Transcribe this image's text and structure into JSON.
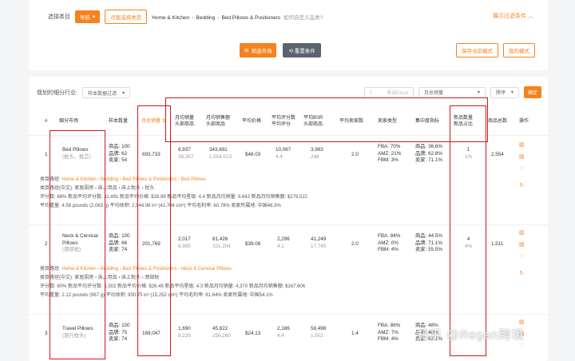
{
  "filters": {
    "category_label": "选择类目",
    "dropdown_label": "导航",
    "choose_category_btn": "点我选择类目",
    "breadcrumb": [
      "Home & Kitchen",
      "Bedding",
      "Bed Pillows & Positioners"
    ],
    "custom_hint": "如何自定义品类?",
    "expand_filters": "展示过滤条件",
    "filter_market_btn": "筛选市场",
    "reset_btn": "重置条件",
    "save_mode_btn": "保存当前模式",
    "my_mode_btn": "我的模式"
  },
  "toolbar": {
    "my_market_label": "我划的细分行业:",
    "sample_select": "样本数据过滤",
    "export": "导出Excel",
    "month_select": "月总销量",
    "order_select": "降序",
    "query_btn": "确定"
  },
  "headers": {
    "no": "#",
    "market": "细分市场",
    "sample": "样本数量",
    "monthly_sales": "月总销量",
    "avg_monthly_sales": [
      "月均销量",
      "头部商品"
    ],
    "avg_monthly_revenue": [
      "月均销售额",
      "头部商品"
    ],
    "avg_price": "平均价格",
    "avg_reviews": [
      "平均评分数",
      "平均评分"
    ],
    "avg_bsr": [
      "平均BSR",
      "头部商品"
    ],
    "avg_sellers": "平均卖家数",
    "seller_type": "卖家类型",
    "concentration": "集中度指标",
    "new_products": [
      "新品数量",
      "新品占比"
    ],
    "total_products": "商品总数",
    "ops": "操作"
  },
  "rows": [
    {
      "name": "Bed Pillows",
      "cn": "(枕头、枕芯)",
      "sample": [
        "商品: 100",
        "品牌: 62",
        "卖家: 54"
      ],
      "monthly_sales": "693,733",
      "avg_sales": [
        "6,937",
        "26,367"
      ],
      "avg_revenue": [
        "343,691",
        "1,554,013"
      ],
      "price": "$48.03",
      "reviews": [
        "10,067",
        "4.4"
      ],
      "bsr": [
        "3,983",
        "248"
      ],
      "sellers": "2.0",
      "seller_type": [
        "FBA: 70%",
        "AMZ: 21%",
        "FBM: 3%"
      ],
      "conc": [
        "商品: 36.6%",
        "品牌: 62.8%",
        "卖家: 71.1%"
      ],
      "new": [
        "1",
        "1%"
      ],
      "total": "2,554",
      "path": "Home & Kitchen › Bedding › Bed Pillows & Positioners › Bed Pillows",
      "path_cn": "家居厨房 › 床上用品 › 床上枕头 › 枕头",
      "stats1": "评分数: 88%    新品平均评分数: 11,491    新品平均价格: $28.99    新品平均星级: 4.4    新品月均销量: 9,642    新品月均销售额: $279,522",
      "stats2": "平均重量: 4.59 pounds (2,083 g)    平均体积: 2,544.96 in³ (41,704 cm³)    平均毛利率: 60.78%    卖家所属地: 中国46.3%"
    },
    {
      "name": "Neck & Cervical Pillows",
      "cn": "(颈部枕)",
      "sample": [
        "商品: 100",
        "品牌: 66",
        "卖家: 74"
      ],
      "monthly_sales": "201,769",
      "avg_sales": [
        "2,017",
        "6,985"
      ],
      "avg_revenue": [
        "81,426",
        "331,204"
      ],
      "price": "$39.06",
      "reviews": [
        "2,296",
        "4.1"
      ],
      "bsr": [
        "41,249",
        "17,745"
      ],
      "sellers": "2.0",
      "seller_type": [
        "FBA: 84%",
        "AMZ: 0%",
        "FBM: 4%"
      ],
      "conc": [
        "商品: 44.5%",
        "品牌: 71.1%",
        "卖家: 55.5%"
      ],
      "new": [
        "4",
        "4%"
      ],
      "total": "1,511",
      "path": "Home & Kitchen › Bedding › Bed Pillows & Positioners › Neck & Cervical Pillows",
      "path_cn": "家居厨房 › 床上用品 › 床上枕头 › 颈部枕",
      "stats1": "评分数: 80%    新品平均评分数: 1,502    新品平均价格: $26.49    新品平均星级: 4.3    新品月均销量: 4,370    新品月均销售额: $167,606",
      "stats2": "平均重量: 2.12 pounds (967 g)    平均体积: 930.75 in³ (15,252 cm³)    平均毛利率: 61.64%    卖家所属地: 中国54.1%"
    },
    {
      "name": "Travel Pillows",
      "cn": "(旅行枕头)",
      "sample": [
        "商品: 100",
        "品牌: 75",
        "卖家: 74"
      ],
      "monthly_sales": "169,047",
      "avg_sales": [
        "1,690",
        "8,226"
      ],
      "avg_revenue": [
        "45,822",
        "256,260"
      ],
      "price": "$24.13",
      "reviews": [
        "2,186",
        "4.4"
      ],
      "bsr": [
        "58,498",
        "1,502"
      ],
      "sellers": "1.4",
      "seller_type": [
        "FBA: 86%",
        "AMZ: 7%",
        "FBM: 4%"
      ],
      "conc": [
        "商品: 48%",
        "品牌: 48%",
        "卖家: 62.1%"
      ],
      "new": [
        "",
        ""
      ],
      "total": "",
      "path": "",
      "path_cn": "",
      "stats1": "",
      "stats2": ""
    }
  ],
  "watermark": "知乎 @Regan跨境",
  "colors": {
    "accent": "#f5821f",
    "highlight_box": "#d2161e"
  }
}
